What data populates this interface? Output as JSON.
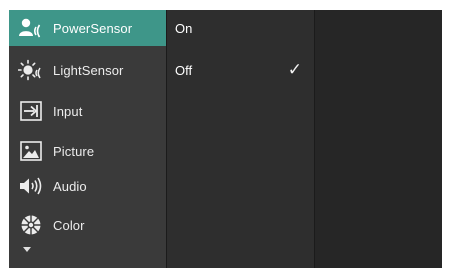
{
  "main_menu": [
    {
      "label": "PowerSensor",
      "icon": "power-sensor-icon",
      "selected": true
    },
    {
      "label": "LightSensor",
      "icon": "light-sensor-icon",
      "selected": false
    },
    {
      "label": "Input",
      "icon": "input-icon",
      "selected": false
    },
    {
      "label": "Picture",
      "icon": "picture-icon",
      "selected": false
    },
    {
      "label": "Audio",
      "icon": "audio-icon",
      "selected": false
    },
    {
      "label": "Color",
      "icon": "color-icon",
      "selected": false
    }
  ],
  "sub_menu": [
    {
      "label": "On",
      "checked": false
    },
    {
      "label": "Off",
      "checked": true
    }
  ],
  "check_glyph": "✓",
  "colors": {
    "accent": "#3e9689",
    "panel": "#3a3a3a",
    "sub_panel": "#2e2e2e",
    "background": "#262626"
  }
}
